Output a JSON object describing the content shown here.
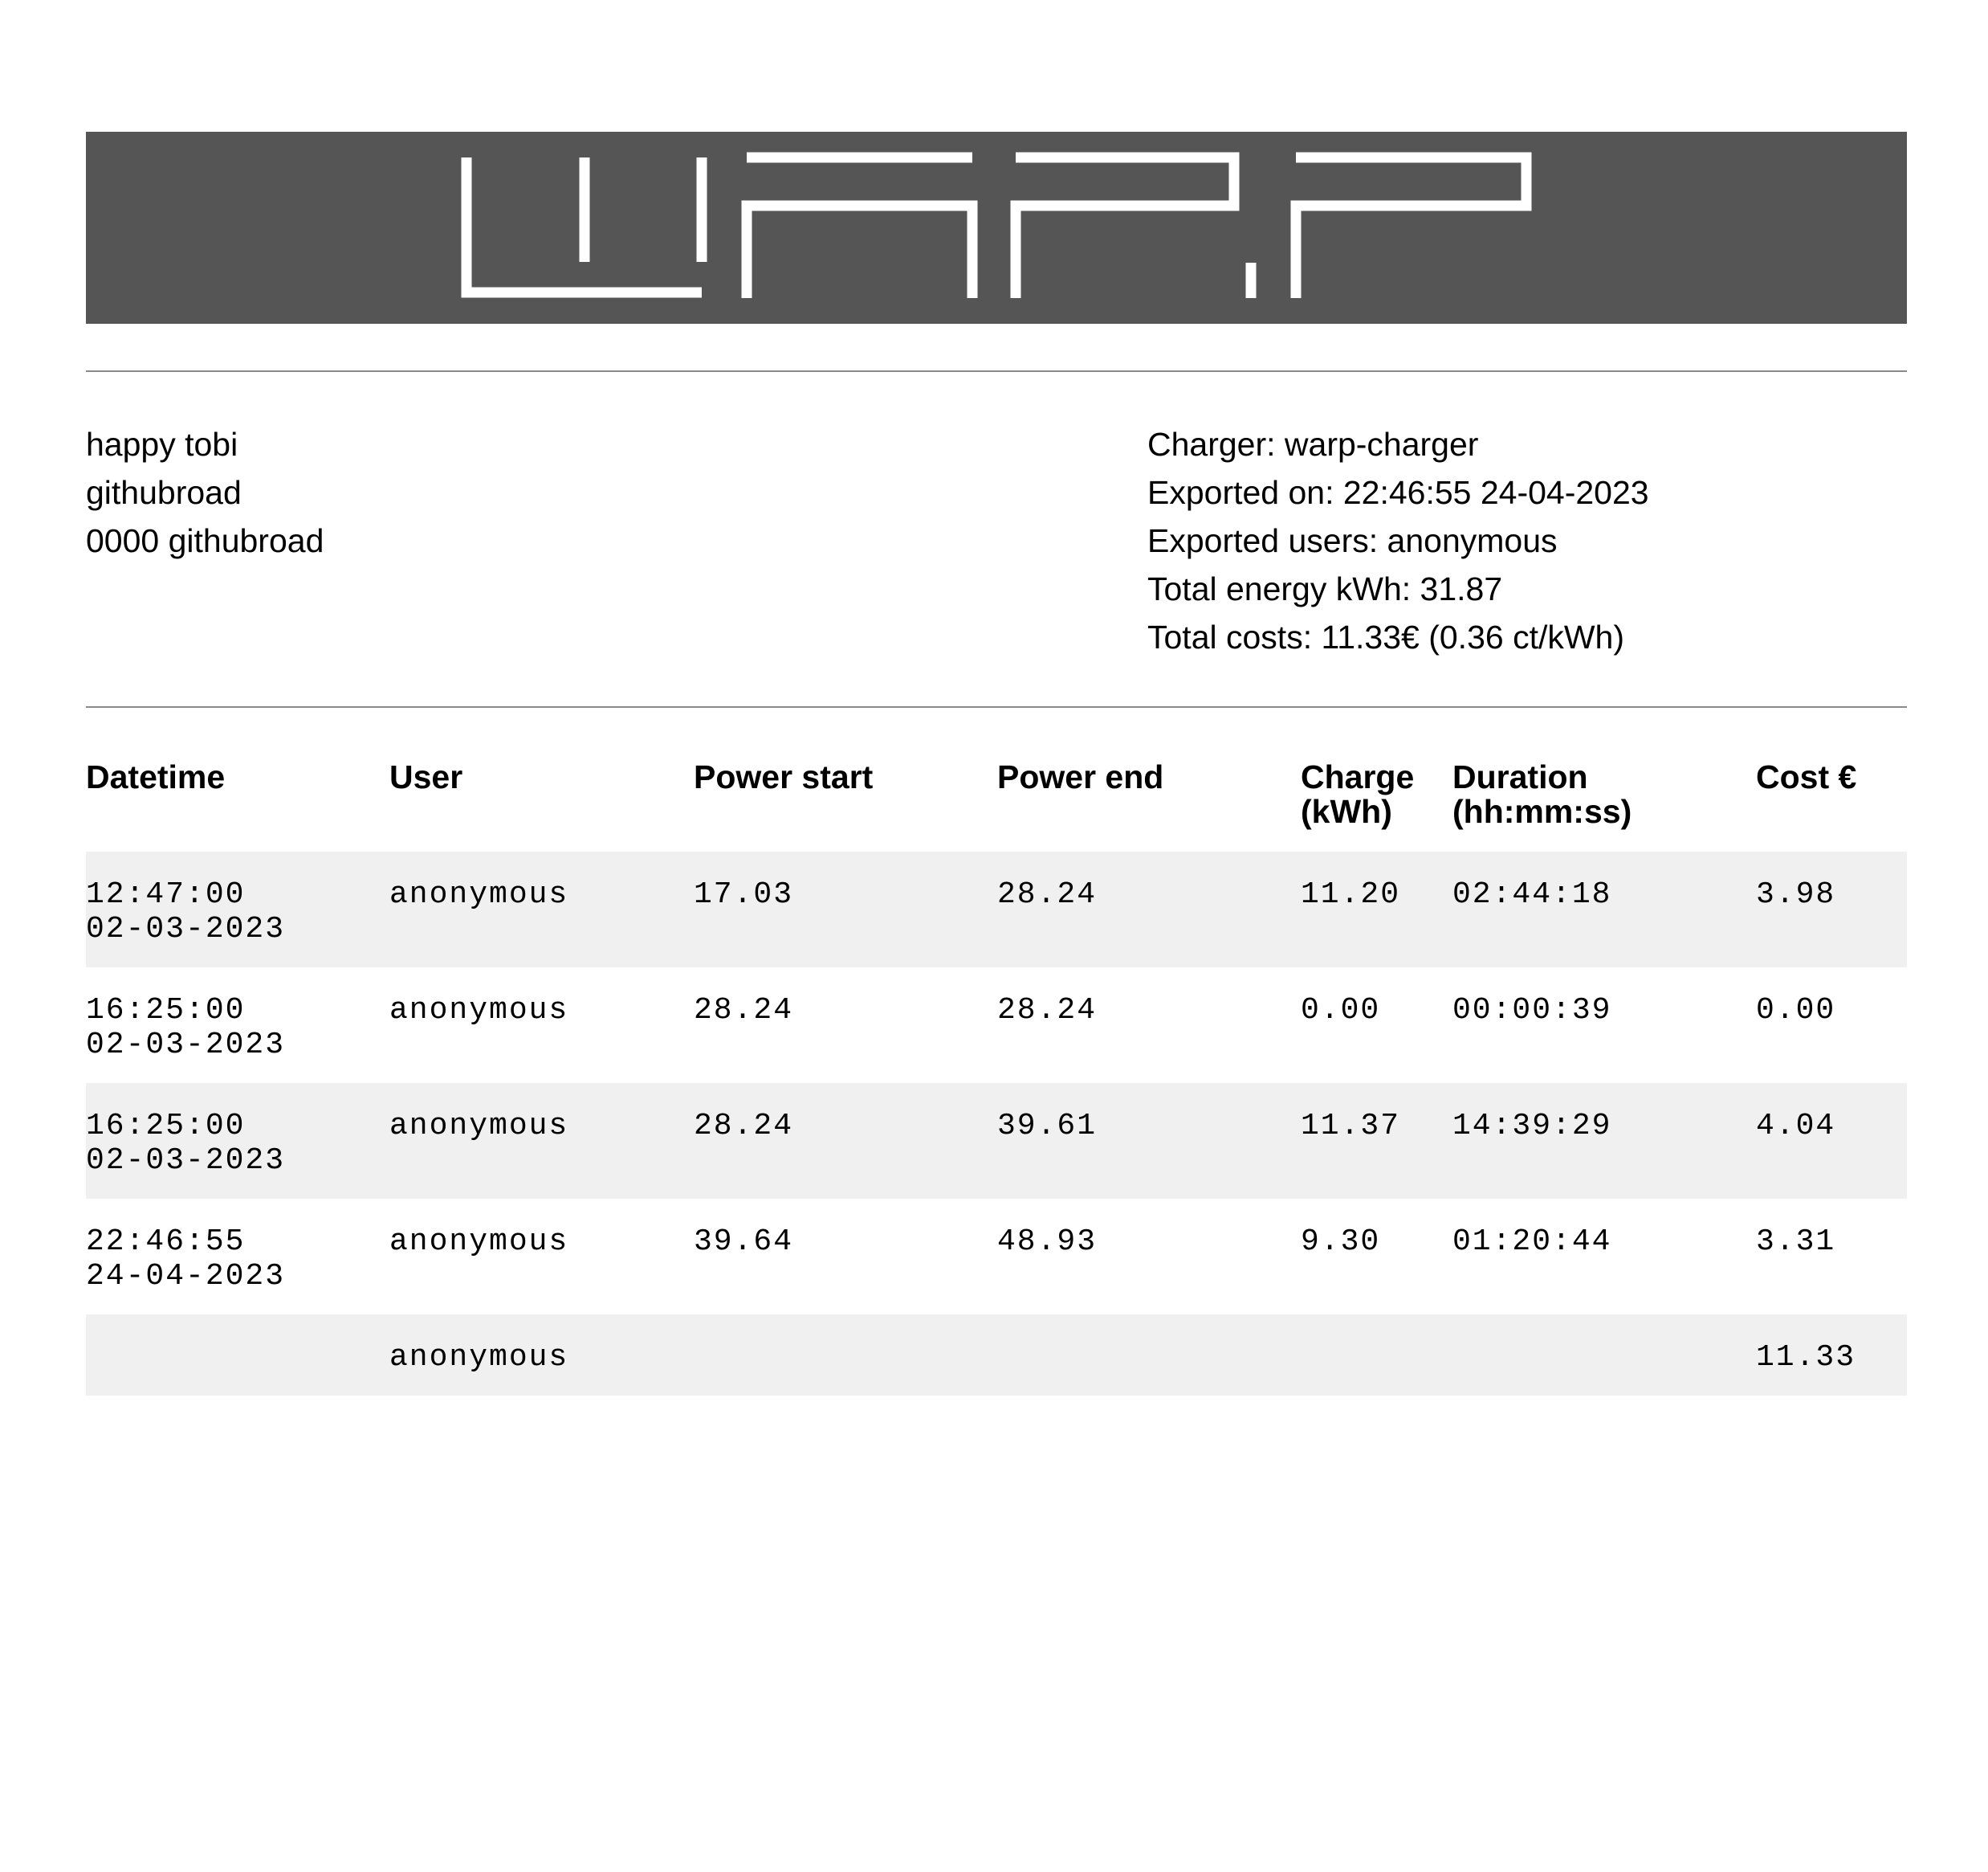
{
  "logo": {
    "text": "WARP",
    "background_color": "#555555",
    "stroke_color": "#ffffff"
  },
  "address": {
    "lines": [
      "happy tobi",
      "githubroad",
      "0000 githubroad"
    ]
  },
  "summary": {
    "charger": "Charger: warp-charger",
    "exported_on": "Exported on: 22:46:55 24-04-2023",
    "exported_users": "Exported users: anonymous",
    "total_energy": "Total energy kWh: 31.87",
    "total_costs": "Total costs: 11.33€ (0.36 ct/kWh)"
  },
  "table": {
    "headers": {
      "datetime": "Datetime",
      "user": "User",
      "power_start": "Power start",
      "power_end": "Power end",
      "charge": "Charge\n(kWh)",
      "duration": "Duration\n(hh:mm:ss)",
      "cost": "Cost €"
    },
    "rows": [
      {
        "time": "12:47:00",
        "date": "02-03-2023",
        "user": "anonymous",
        "power_start": "17.03",
        "power_end": "28.24",
        "charge": "11.20",
        "duration": "02:44:18",
        "cost": "3.98"
      },
      {
        "time": "16:25:00",
        "date": "02-03-2023",
        "user": "anonymous",
        "power_start": "28.24",
        "power_end": "28.24",
        "charge": "0.00",
        "duration": "00:00:39",
        "cost": "0.00"
      },
      {
        "time": "16:25:00",
        "date": "02-03-2023",
        "user": "anonymous",
        "power_start": "28.24",
        "power_end": "39.61",
        "charge": "11.37",
        "duration": "14:39:29",
        "cost": "4.04"
      },
      {
        "time": "22:46:55",
        "date": "24-04-2023",
        "user": "anonymous",
        "power_start": "39.64",
        "power_end": "48.93",
        "charge": "9.30",
        "duration": "01:20:44",
        "cost": "3.31"
      }
    ],
    "total": {
      "user": "anonymous",
      "cost": "11.33"
    },
    "stripe_color": "#f0f0f0"
  }
}
